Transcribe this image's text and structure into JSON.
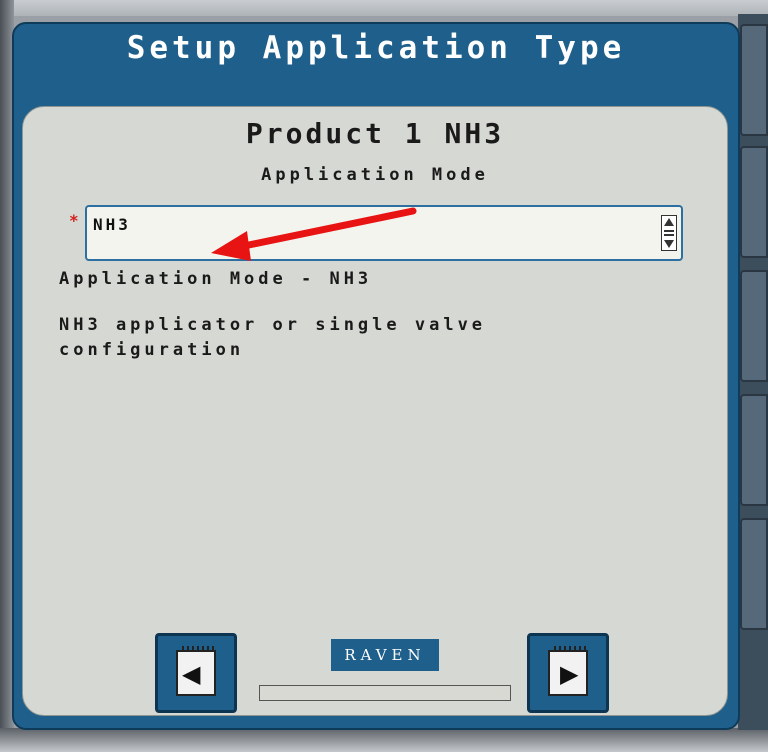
{
  "header": {
    "title": "Setup Application Type"
  },
  "panel": {
    "product_title": "Product 1 NH3",
    "mode_label": "Application Mode",
    "required_marker": "*",
    "mode_select": {
      "value": "NH3"
    },
    "section_heading": "Application Mode - NH3",
    "description": "NH3 applicator or single valve configuration"
  },
  "footer": {
    "brand": "RAVEN",
    "progress": 0.0
  },
  "icons": {
    "prev": "back-page-icon",
    "next": "next-page-icon",
    "scroll": "scroll-updown-icon"
  },
  "colors": {
    "header_blue": "#1f5f8c",
    "panel_gray": "#d6d9d3",
    "required_red": "#d32020",
    "annotation_arrow": "#e81414"
  }
}
